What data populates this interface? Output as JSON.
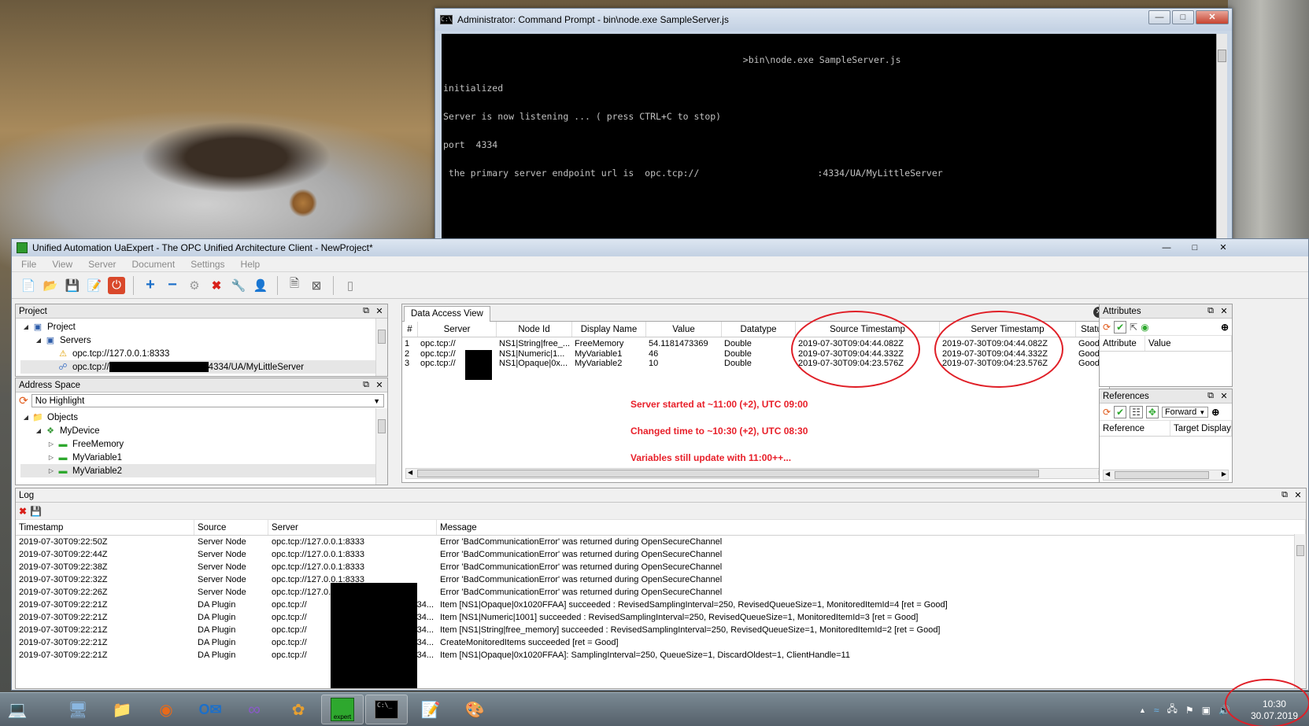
{
  "cmd": {
    "title": "Administrator: Command Prompt - bin\\node.exe  SampleServer.js",
    "icon_text": "C:\\",
    "lines": [
      "                                                       >bin\\node.exe SampleServer.js",
      "initialized",
      "Server is now listening ... ( press CTRL+C to stop)",
      "port  4334",
      " the primary server endpoint url is  opc.tcp://",
      ":4334/UA/MyLittleServer"
    ]
  },
  "ua": {
    "title": "Unified Automation UaExpert - The OPC Unified Architecture Client - NewProject*",
    "menu": [
      "File",
      "View",
      "Server",
      "Document",
      "Settings",
      "Help"
    ],
    "project": {
      "header": "Project",
      "items": [
        "Project",
        "Servers",
        "opc.tcp://127.0.0.1:8333",
        "opc.tcp://",
        "4334/UA/MyLittleServer"
      ]
    },
    "address_space": {
      "header": "Address Space",
      "filter": "No Highlight",
      "items": [
        "Objects",
        "MyDevice",
        "FreeMemory",
        "MyVariable1",
        "MyVariable2"
      ]
    },
    "dav": {
      "tab": "Data Access View",
      "columns": [
        "#",
        "Server",
        "Node Id",
        "Display Name",
        "Value",
        "Datatype",
        "Source Timestamp",
        "Server Timestamp",
        "Statu"
      ],
      "rows": [
        {
          "n": "1",
          "server": "opc.tcp://",
          "node": "NS1|String|free_...",
          "name": "FreeMemory",
          "value": "54.1181473369",
          "type": "Double",
          "src": "2019-07-30T09:04:44.082Z",
          "srv": "2019-07-30T09:04:44.082Z",
          "status": "Good"
        },
        {
          "n": "2",
          "server": "opc.tcp://",
          "node": "NS1|Numeric|1...",
          "name": "MyVariable1",
          "value": "46",
          "type": "Double",
          "src": "2019-07-30T09:04:44.332Z",
          "srv": "2019-07-30T09:04:44.332Z",
          "status": "Good"
        },
        {
          "n": "3",
          "server": "opc.tcp://",
          "node": "NS1|Opaque|0x...",
          "name": "MyVariable2",
          "value": "10",
          "type": "Double",
          "src": "2019-07-30T09:04:23.576Z",
          "srv": "2019-07-30T09:04:23.576Z",
          "status": "Good"
        }
      ],
      "annotations": [
        "Server started at ~11:00 (+2), UTC 09:00",
        "Changed time to ~10:30 (+2), UTC 08:30",
        "Variables still update with 11:00++..."
      ]
    },
    "attributes": {
      "header": "Attributes",
      "columns": [
        "Attribute",
        "Value"
      ]
    },
    "references": {
      "header": "References",
      "direction": "Forward",
      "columns": [
        "Reference",
        "Target Display"
      ]
    },
    "log": {
      "header": "Log",
      "columns": [
        "Timestamp",
        "Source",
        "Server",
        "Message"
      ],
      "rows": [
        {
          "ts": "2019-07-30T09:22:50Z",
          "src": "Server Node",
          "srv": "opc.tcp://127.0.0.1:8333",
          "msg": "Error 'BadCommunicationError' was returned during OpenSecureChannel"
        },
        {
          "ts": "2019-07-30T09:22:44Z",
          "src": "Server Node",
          "srv": "opc.tcp://127.0.0.1:8333",
          "msg": "Error 'BadCommunicationError' was returned during OpenSecureChannel"
        },
        {
          "ts": "2019-07-30T09:22:38Z",
          "src": "Server Node",
          "srv": "opc.tcp://127.0.0.1:8333",
          "msg": "Error 'BadCommunicationError' was returned during OpenSecureChannel"
        },
        {
          "ts": "2019-07-30T09:22:32Z",
          "src": "Server Node",
          "srv": "opc.tcp://127.0.0.1:8333",
          "msg": "Error 'BadCommunicationError' was returned during OpenSecureChannel"
        },
        {
          "ts": "2019-07-30T09:22:26Z",
          "src": "Server Node",
          "srv": "opc.tcp://127.0.0.1:8333",
          "msg": "Error 'BadCommunicationError' was returned during OpenSecureChannel"
        },
        {
          "ts": "2019-07-30T09:22:21Z",
          "src": "DA Plugin",
          "srv": "opc.tcp://",
          "srv_tail": "4334...",
          "msg": "Item [NS1|Opaque|0x1020FFAA] succeeded : RevisedSamplingInterval=250, RevisedQueueSize=1, MonitoredItemId=4 [ret = Good]"
        },
        {
          "ts": "2019-07-30T09:22:21Z",
          "src": "DA Plugin",
          "srv": "opc.tcp://",
          "srv_tail": "4334...",
          "msg": "Item [NS1|Numeric|1001] succeeded : RevisedSamplingInterval=250, RevisedQueueSize=1, MonitoredItemId=3 [ret = Good]"
        },
        {
          "ts": "2019-07-30T09:22:21Z",
          "src": "DA Plugin",
          "srv": "opc.tcp://",
          "srv_tail": "4334...",
          "msg": "Item [NS1|String|free_memory] succeeded : RevisedSamplingInterval=250, RevisedQueueSize=1, MonitoredItemId=2 [ret = Good]"
        },
        {
          "ts": "2019-07-30T09:22:21Z",
          "src": "DA Plugin",
          "srv": "opc.tcp://",
          "srv_tail": "4334...",
          "msg": "CreateMonitoredItems succeeded [ret = Good]"
        },
        {
          "ts": "2019-07-30T09:22:21Z",
          "src": "DA Plugin",
          "srv": "opc.tcp://",
          "srv_tail": "4334...",
          "msg": "Item [NS1|Opaque|0x1020FFAA]: SamplingInterval=250, QueueSize=1, DiscardOldest=1, ClientHandle=11"
        }
      ]
    }
  },
  "taskbar": {
    "clock_time": "10:30",
    "clock_date": "30.07.2019",
    "uaexpert_label": "expert",
    "cmd_label": "C:\\_"
  },
  "colors": {
    "annotation": "#e8202a",
    "ellipse": "#e01f27"
  }
}
